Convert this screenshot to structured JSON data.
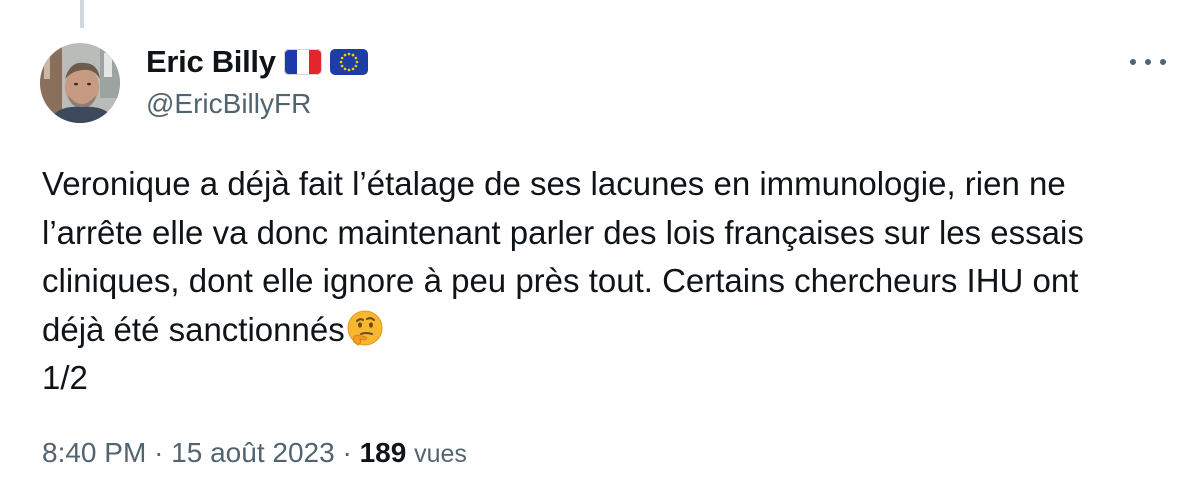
{
  "author": {
    "display_name": "Eric Billy",
    "handle": "@EricBillyFR",
    "flags": [
      "flag-france-icon",
      "flag-eu-icon"
    ]
  },
  "tweet": {
    "lines": [
      "Veronique a déjà fait l’étalage de ses lacunes en immunologie, rien ne",
      "l’arrête elle va donc maintenant parler des lois françaises sur les essais",
      "cliniques, dont elle ignore à peu près tout. Certains chercheurs IHU ont",
      "déjà été sanctionnés",
      "1/2"
    ],
    "emoji": "thinking-face-icon"
  },
  "meta": {
    "time": "8:40 PM",
    "separator": "·",
    "date": "15 août 2023",
    "views_count": "189",
    "views_label": "vues"
  },
  "colors": {
    "text_primary": "#0f1419",
    "text_secondary": "#536471",
    "thread_line": "#cfd9de"
  }
}
